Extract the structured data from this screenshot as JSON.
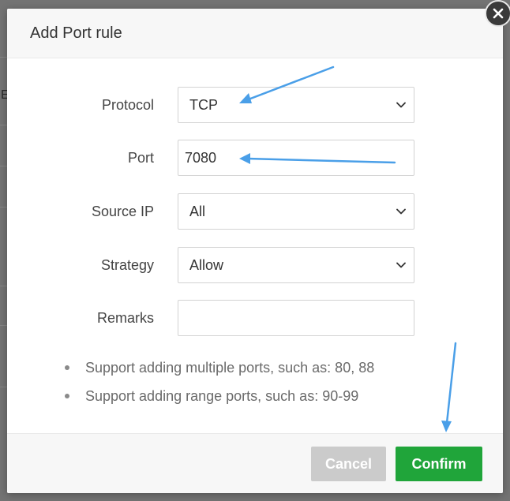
{
  "dialog": {
    "title": "Add Port rule"
  },
  "form": {
    "protocol": {
      "label": "Protocol",
      "value": "TCP"
    },
    "port": {
      "label": "Port",
      "value": "7080",
      "placeholder": ""
    },
    "source_ip": {
      "label": "Source IP",
      "value": "All"
    },
    "strategy": {
      "label": "Strategy",
      "value": "Allow"
    },
    "remarks": {
      "label": "Remarks",
      "value": ""
    }
  },
  "notes": [
    "Support adding multiple ports, such as: 80, 88",
    "Support adding range ports, such as: 90-99"
  ],
  "buttons": {
    "cancel": "Cancel",
    "confirm": "Confirm"
  },
  "background": {
    "partial_char": "E"
  },
  "icons": {
    "close": "close-icon",
    "chevron": "chevron-down-icon"
  },
  "colors": {
    "confirm": "#20a53a",
    "cancel": "#cbcbcb",
    "annotation_arrow": "#4a9fe8",
    "overlay": "#737373"
  }
}
